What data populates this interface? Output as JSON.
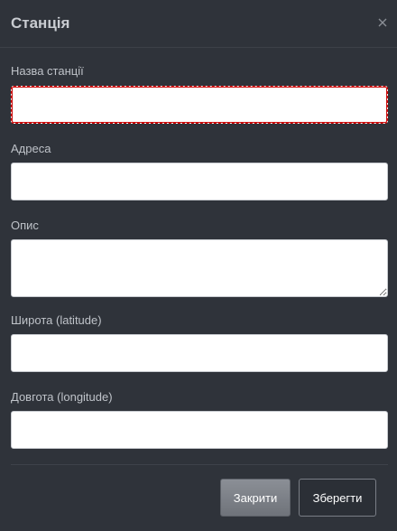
{
  "dialog": {
    "title": "Станція",
    "close_icon": "close-icon"
  },
  "form": {
    "station_name": {
      "label": "Назва станції",
      "value": "",
      "state": "invalid"
    },
    "address": {
      "label": "Адреса",
      "value": ""
    },
    "description": {
      "label": "Опис",
      "value": ""
    },
    "latitude": {
      "label": "Широта (latitude)",
      "value": ""
    },
    "longitude": {
      "label": "Довгота (longitude)",
      "value": ""
    }
  },
  "footer": {
    "close_label": "Закрити",
    "save_label": "Зберегти"
  },
  "colors": {
    "background": "#2f333a",
    "invalid_border": "#cc0000",
    "text": "#c9ccd1"
  }
}
